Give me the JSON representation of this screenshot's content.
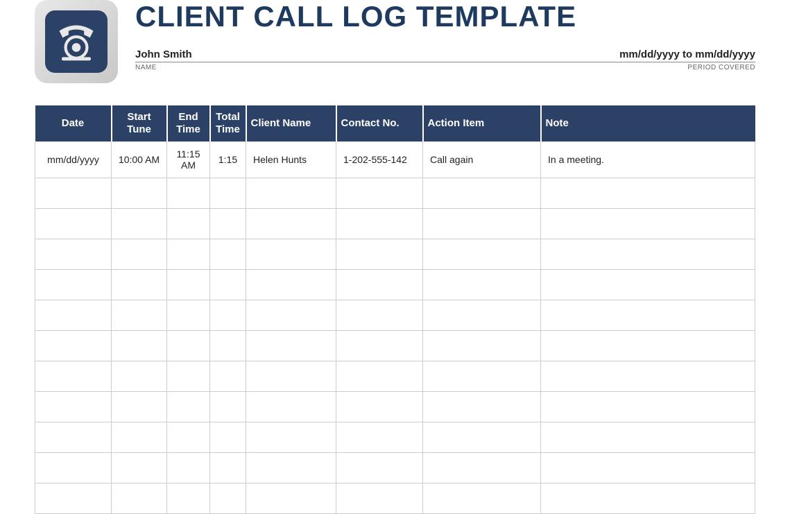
{
  "header": {
    "title": "CLIENT CALL LOG TEMPLATE",
    "name_value": "John Smith",
    "name_label": "NAME",
    "period_value": "mm/dd/yyyy to mm/dd/yyyy",
    "period_label": "PERIOD COVERED"
  },
  "table": {
    "columns": {
      "date": "Date",
      "start": "Start Tune",
      "end": "End Time",
      "total": "Total Time",
      "client": "Client Name",
      "contact": "Contact No.",
      "action": "Action Item",
      "note": "Note"
    },
    "rows": [
      {
        "date": "mm/dd/yyyy",
        "start": "10:00 AM",
        "end": "11:15 AM",
        "total": "1:15",
        "client": "Helen Hunts",
        "contact": "1-202-555-142",
        "action": "Call again",
        "note": "In a meeting."
      },
      {
        "date": "",
        "start": "",
        "end": "",
        "total": "",
        "client": "",
        "contact": "",
        "action": "",
        "note": ""
      },
      {
        "date": "",
        "start": "",
        "end": "",
        "total": "",
        "client": "",
        "contact": "",
        "action": "",
        "note": ""
      },
      {
        "date": "",
        "start": "",
        "end": "",
        "total": "",
        "client": "",
        "contact": "",
        "action": "",
        "note": ""
      },
      {
        "date": "",
        "start": "",
        "end": "",
        "total": "",
        "client": "",
        "contact": "",
        "action": "",
        "note": ""
      },
      {
        "date": "",
        "start": "",
        "end": "",
        "total": "",
        "client": "",
        "contact": "",
        "action": "",
        "note": ""
      },
      {
        "date": "",
        "start": "",
        "end": "",
        "total": "",
        "client": "",
        "contact": "",
        "action": "",
        "note": ""
      },
      {
        "date": "",
        "start": "",
        "end": "",
        "total": "",
        "client": "",
        "contact": "",
        "action": "",
        "note": ""
      },
      {
        "date": "",
        "start": "",
        "end": "",
        "total": "",
        "client": "",
        "contact": "",
        "action": "",
        "note": ""
      },
      {
        "date": "",
        "start": "",
        "end": "",
        "total": "",
        "client": "",
        "contact": "",
        "action": "",
        "note": ""
      },
      {
        "date": "",
        "start": "",
        "end": "",
        "total": "",
        "client": "",
        "contact": "",
        "action": "",
        "note": ""
      },
      {
        "date": "",
        "start": "",
        "end": "",
        "total": "",
        "client": "",
        "contact": "",
        "action": "",
        "note": ""
      }
    ]
  }
}
